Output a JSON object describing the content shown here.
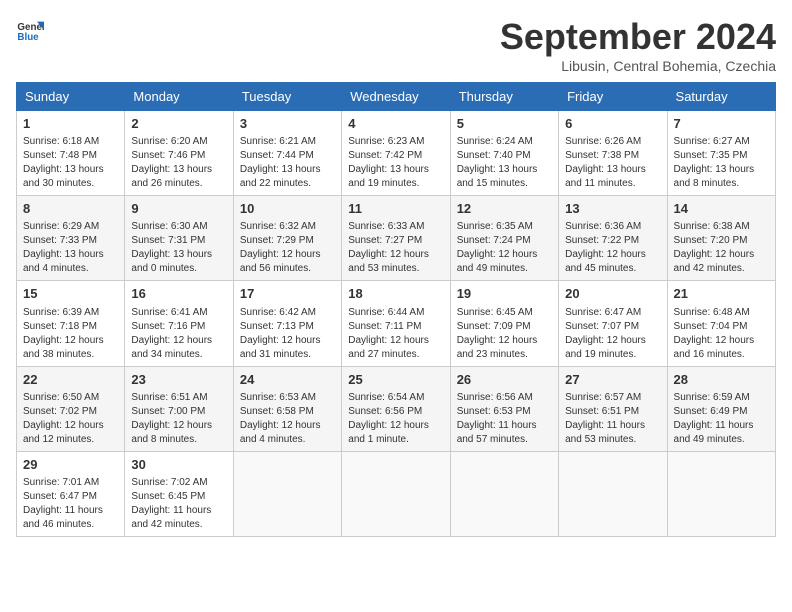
{
  "header": {
    "logo_general": "General",
    "logo_blue": "Blue",
    "month_title": "September 2024",
    "location": "Libusin, Central Bohemia, Czechia"
  },
  "weekdays": [
    "Sunday",
    "Monday",
    "Tuesday",
    "Wednesday",
    "Thursday",
    "Friday",
    "Saturday"
  ],
  "weeks": [
    [
      {
        "day": "1",
        "info": "Sunrise: 6:18 AM\nSunset: 7:48 PM\nDaylight: 13 hours\nand 30 minutes."
      },
      {
        "day": "2",
        "info": "Sunrise: 6:20 AM\nSunset: 7:46 PM\nDaylight: 13 hours\nand 26 minutes."
      },
      {
        "day": "3",
        "info": "Sunrise: 6:21 AM\nSunset: 7:44 PM\nDaylight: 13 hours\nand 22 minutes."
      },
      {
        "day": "4",
        "info": "Sunrise: 6:23 AM\nSunset: 7:42 PM\nDaylight: 13 hours\nand 19 minutes."
      },
      {
        "day": "5",
        "info": "Sunrise: 6:24 AM\nSunset: 7:40 PM\nDaylight: 13 hours\nand 15 minutes."
      },
      {
        "day": "6",
        "info": "Sunrise: 6:26 AM\nSunset: 7:38 PM\nDaylight: 13 hours\nand 11 minutes."
      },
      {
        "day": "7",
        "info": "Sunrise: 6:27 AM\nSunset: 7:35 PM\nDaylight: 13 hours\nand 8 minutes."
      }
    ],
    [
      {
        "day": "8",
        "info": "Sunrise: 6:29 AM\nSunset: 7:33 PM\nDaylight: 13 hours\nand 4 minutes."
      },
      {
        "day": "9",
        "info": "Sunrise: 6:30 AM\nSunset: 7:31 PM\nDaylight: 13 hours\nand 0 minutes."
      },
      {
        "day": "10",
        "info": "Sunrise: 6:32 AM\nSunset: 7:29 PM\nDaylight: 12 hours\nand 56 minutes."
      },
      {
        "day": "11",
        "info": "Sunrise: 6:33 AM\nSunset: 7:27 PM\nDaylight: 12 hours\nand 53 minutes."
      },
      {
        "day": "12",
        "info": "Sunrise: 6:35 AM\nSunset: 7:24 PM\nDaylight: 12 hours\nand 49 minutes."
      },
      {
        "day": "13",
        "info": "Sunrise: 6:36 AM\nSunset: 7:22 PM\nDaylight: 12 hours\nand 45 minutes."
      },
      {
        "day": "14",
        "info": "Sunrise: 6:38 AM\nSunset: 7:20 PM\nDaylight: 12 hours\nand 42 minutes."
      }
    ],
    [
      {
        "day": "15",
        "info": "Sunrise: 6:39 AM\nSunset: 7:18 PM\nDaylight: 12 hours\nand 38 minutes."
      },
      {
        "day": "16",
        "info": "Sunrise: 6:41 AM\nSunset: 7:16 PM\nDaylight: 12 hours\nand 34 minutes."
      },
      {
        "day": "17",
        "info": "Sunrise: 6:42 AM\nSunset: 7:13 PM\nDaylight: 12 hours\nand 31 minutes."
      },
      {
        "day": "18",
        "info": "Sunrise: 6:44 AM\nSunset: 7:11 PM\nDaylight: 12 hours\nand 27 minutes."
      },
      {
        "day": "19",
        "info": "Sunrise: 6:45 AM\nSunset: 7:09 PM\nDaylight: 12 hours\nand 23 minutes."
      },
      {
        "day": "20",
        "info": "Sunrise: 6:47 AM\nSunset: 7:07 PM\nDaylight: 12 hours\nand 19 minutes."
      },
      {
        "day": "21",
        "info": "Sunrise: 6:48 AM\nSunset: 7:04 PM\nDaylight: 12 hours\nand 16 minutes."
      }
    ],
    [
      {
        "day": "22",
        "info": "Sunrise: 6:50 AM\nSunset: 7:02 PM\nDaylight: 12 hours\nand 12 minutes."
      },
      {
        "day": "23",
        "info": "Sunrise: 6:51 AM\nSunset: 7:00 PM\nDaylight: 12 hours\nand 8 minutes."
      },
      {
        "day": "24",
        "info": "Sunrise: 6:53 AM\nSunset: 6:58 PM\nDaylight: 12 hours\nand 4 minutes."
      },
      {
        "day": "25",
        "info": "Sunrise: 6:54 AM\nSunset: 6:56 PM\nDaylight: 12 hours\nand 1 minute."
      },
      {
        "day": "26",
        "info": "Sunrise: 6:56 AM\nSunset: 6:53 PM\nDaylight: 11 hours\nand 57 minutes."
      },
      {
        "day": "27",
        "info": "Sunrise: 6:57 AM\nSunset: 6:51 PM\nDaylight: 11 hours\nand 53 minutes."
      },
      {
        "day": "28",
        "info": "Sunrise: 6:59 AM\nSunset: 6:49 PM\nDaylight: 11 hours\nand 49 minutes."
      }
    ],
    [
      {
        "day": "29",
        "info": "Sunrise: 7:01 AM\nSunset: 6:47 PM\nDaylight: 11 hours\nand 46 minutes."
      },
      {
        "day": "30",
        "info": "Sunrise: 7:02 AM\nSunset: 6:45 PM\nDaylight: 11 hours\nand 42 minutes."
      },
      {
        "day": "",
        "info": ""
      },
      {
        "day": "",
        "info": ""
      },
      {
        "day": "",
        "info": ""
      },
      {
        "day": "",
        "info": ""
      },
      {
        "day": "",
        "info": ""
      }
    ]
  ]
}
